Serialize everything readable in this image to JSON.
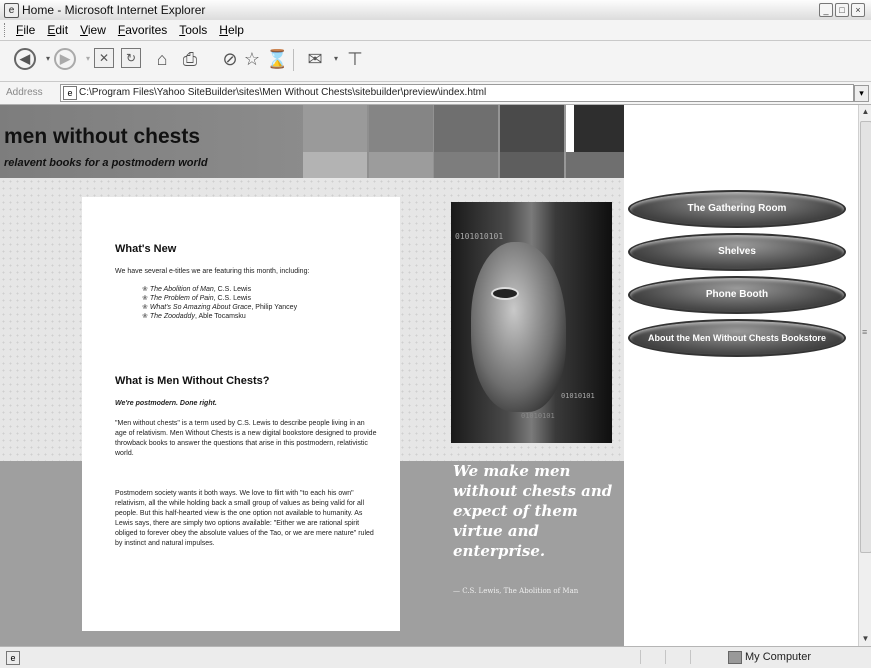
{
  "window": {
    "title": "Home - Microsoft Internet Explorer",
    "ie_icon": "ie-icon",
    "controls": [
      "minimize-icon",
      "maximize-icon",
      "close-icon"
    ]
  },
  "menu": {
    "items": [
      "File",
      "Edit",
      "View",
      "Favorites",
      "Tools",
      "Help"
    ]
  },
  "toolbar": {
    "buttons": [
      "back-icon",
      "forward-icon",
      "stop-icon",
      "refresh-icon",
      "home-icon",
      "print-icon",
      "search-icon",
      "favorites-icon",
      "history-icon",
      "mail-icon",
      "messenger-icon"
    ]
  },
  "address": {
    "label": "Address",
    "url": "C:\\Program Files\\Yahoo SiteBuilder\\sites\\Men Without Chests\\sitebuilder\\preview\\index.html"
  },
  "page": {
    "site_title": "men without chests",
    "tagline": "relavent books for a postmodern world",
    "header_swatches_top": [
      "#9a9a9a",
      "#858585",
      "#6f6f6f",
      "#4a4a4a",
      "#ffffff",
      "#2e2e2e"
    ],
    "header_swatches_bottom": [
      "#b3b3b3",
      "#9c9c9c",
      "#7d7d7d",
      "#5e5e5e",
      "#6f6f6f"
    ],
    "whats_new": {
      "heading": "What's New",
      "intro": "We have several e-titles we are featuring this month, including:",
      "titles": [
        {
          "title": "The Abolition of Man",
          "author": ", C.S. Lewis"
        },
        {
          "title": "The Problem of Pain",
          "author": ", C.S. Lewis"
        },
        {
          "title": "What's So Amazing About Grace",
          "author": ", Philip Yancey"
        },
        {
          "title": "The Zoodaddy",
          "author": ", Able Tocamsku"
        }
      ]
    },
    "about": {
      "heading": "What is Men Without Chests?",
      "subheading": "We're postmodern. Done right.",
      "p1": "\"Men without chests\" is a term used by C.S. Lewis to describe people living in an age of relativism. Men Without Chests is a new digital bookstore designed to provide throwback books to answer the questions that arise in this postmodern, relativistic world.",
      "p2": "Postmodern society wants it both ways. We love to flirt with \"to each his own\" relativism, all the while holding back a small group of values as being valid for all people. But this half-hearted view is the one option not available to humanity. As Lewis says, there are simply two options available: \"Either we are rational spirit obliged to forever obey the absolute values of the Tao, or we are mere nature\" ruled by instinct and natural impulses."
    },
    "image_binary": [
      "0101010101",
      "01010101",
      "01010101"
    ],
    "quote": "We make men without chests and expect of them virtue and enterprise.",
    "quote_source": "— C.S. Lewis, The Abolition of Man",
    "nav": [
      "The Gathering Room",
      "Shelves",
      "Phone Booth",
      "About the Men Without Chests Bookstore"
    ]
  },
  "status": {
    "zone": "My Computer"
  }
}
